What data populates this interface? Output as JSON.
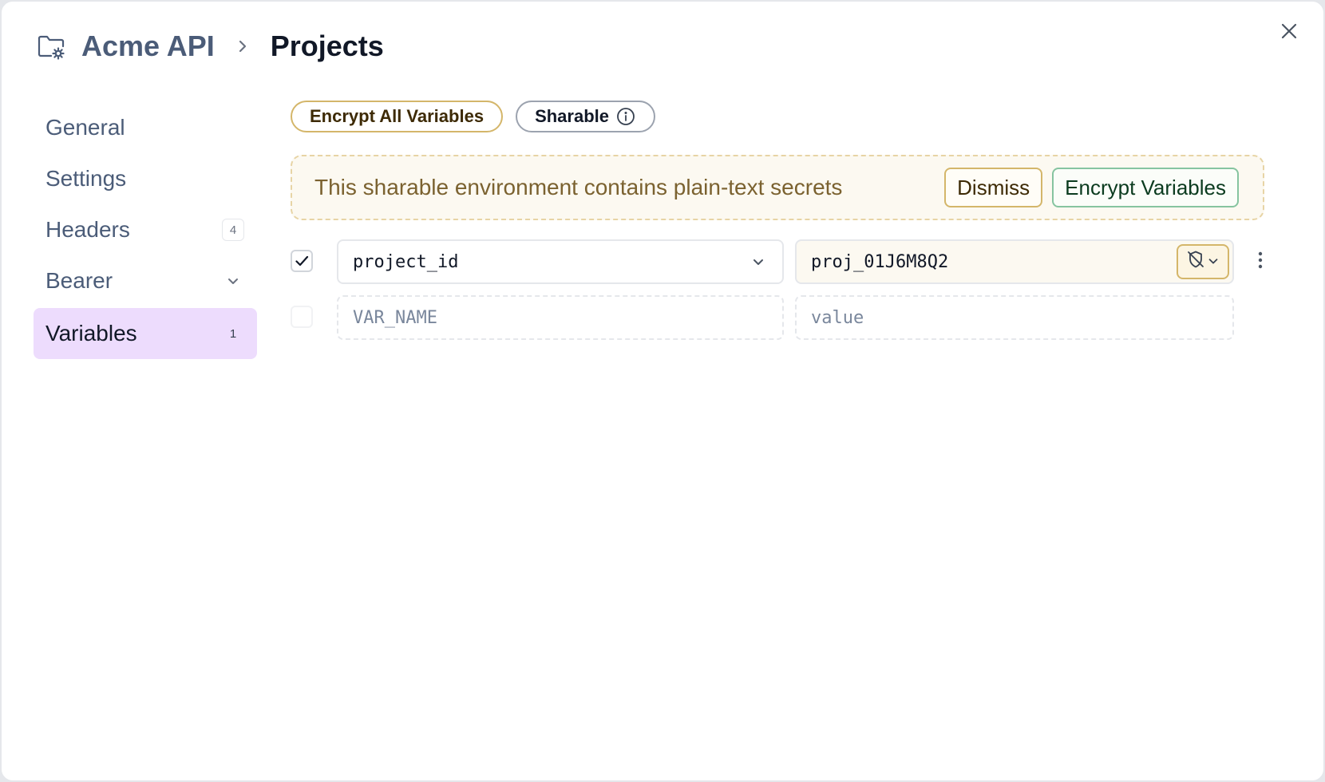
{
  "breadcrumb": {
    "parent": "Acme API",
    "current": "Projects"
  },
  "sidebar": {
    "items": [
      {
        "label": "General"
      },
      {
        "label": "Settings"
      },
      {
        "label": "Headers",
        "badge": "4"
      },
      {
        "label": "Bearer"
      },
      {
        "label": "Variables",
        "badge": "1"
      }
    ]
  },
  "toolbar": {
    "encrypt_all_label": "Encrypt All Variables",
    "sharable_label": "Sharable"
  },
  "banner": {
    "message": "This sharable environment contains plain-text secrets",
    "dismiss_label": "Dismiss",
    "encrypt_label": "Encrypt Variables"
  },
  "variables": [
    {
      "name": "project_id",
      "value": "proj_01J6M8Q2",
      "enabled": true
    }
  ],
  "new_variable": {
    "name_placeholder": "VAR_NAME",
    "value_placeholder": "value"
  },
  "colors": {
    "active_nav_bg": "#eddcfd",
    "banner_bg": "#fcf9f1",
    "warning_border": "#d4b66a",
    "success_border": "#86c4a0"
  },
  "icons": {
    "folder": "folder-settings-icon",
    "separator": "chevron-right-icon",
    "close": "close-icon",
    "info": "info-icon",
    "secret": "shield-off-icon",
    "menu": "more-vertical-icon"
  }
}
